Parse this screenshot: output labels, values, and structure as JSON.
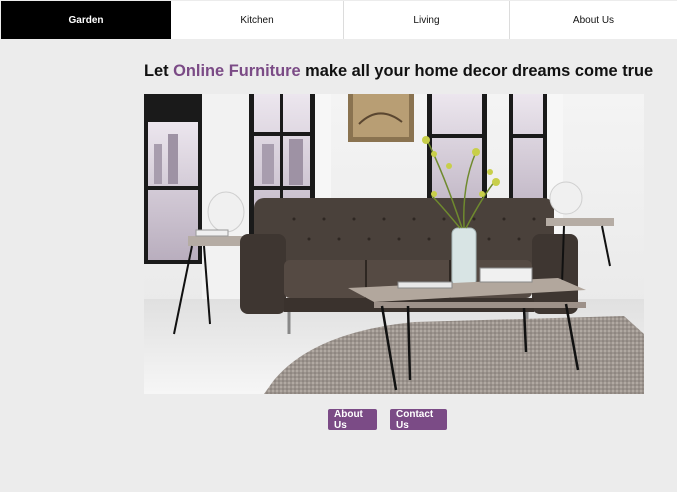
{
  "nav": {
    "items": [
      {
        "label": "Garden",
        "active": true
      },
      {
        "label": "Kitchen",
        "active": false
      },
      {
        "label": "Living",
        "active": false
      },
      {
        "label": "About Us",
        "active": false
      }
    ]
  },
  "headline": {
    "prefix": "Let ",
    "accent": "Online Furniture",
    "suffix": " make all your home decor dreams come true"
  },
  "buttons": {
    "about": "About Us",
    "contact": "Contact Us"
  },
  "colors": {
    "accent": "#7b4b86",
    "nav_active_bg": "#000000",
    "page_bg": "#ececec"
  }
}
